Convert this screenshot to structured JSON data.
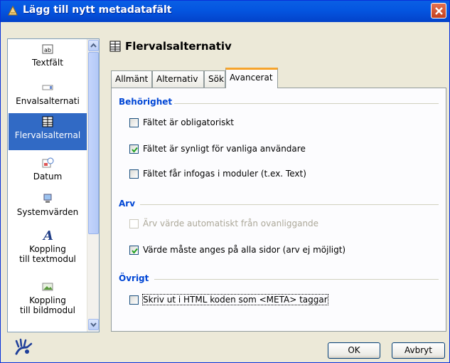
{
  "window": {
    "title": "Lägg till nytt metadatafält"
  },
  "sidebar": {
    "items": [
      {
        "label": "Textfält",
        "icon": "text-field-icon"
      },
      {
        "label": "Envalsalternati",
        "icon": "single-choice-icon"
      },
      {
        "label": "Flervalsalternal",
        "icon": "multi-choice-icon"
      },
      {
        "label": "Datum",
        "icon": "calendar-icon"
      },
      {
        "label": "Systemvärden",
        "icon": "system-values-icon"
      },
      {
        "label": "Koppling\ntill textmodul",
        "icon": "text-module-icon"
      },
      {
        "label": "Koppling\ntill bildmodul",
        "icon": "image-module-icon"
      }
    ],
    "selected_index": 2
  },
  "panel": {
    "title": "Flervalsalternativ",
    "tabs": [
      "Allmänt",
      "Alternativ",
      "Sök",
      "Avancerat"
    ],
    "active_tab": "Avancerat",
    "groups": {
      "behorighet": {
        "title": "Behörighet",
        "options": [
          {
            "label": "Fältet är obligatoriskt",
            "checked": false
          },
          {
            "label": "Fältet är synligt för vanliga användare",
            "checked": true
          },
          {
            "label": "Fältet får infogas i moduler (t.ex. Text)",
            "checked": false
          }
        ]
      },
      "arv": {
        "title": "Arv",
        "options": [
          {
            "label": "Ärv värde automatiskt från ovanliggande",
            "checked": false,
            "disabled": true
          },
          {
            "label": "Värde måste anges på alla sidor (arv ej möjligt)",
            "checked": true
          }
        ]
      },
      "ovrigt": {
        "title": "Övrigt",
        "options": [
          {
            "label": "Skriv ut i HTML koden som <META> taggar",
            "checked": false
          }
        ]
      }
    }
  },
  "buttons": {
    "ok": "OK",
    "cancel": "Avbryt"
  },
  "colors": {
    "titlebar": "#0455e0",
    "group_title": "#0046d5",
    "selected": "#316ac5",
    "tab_accent": "#f6a42c"
  }
}
